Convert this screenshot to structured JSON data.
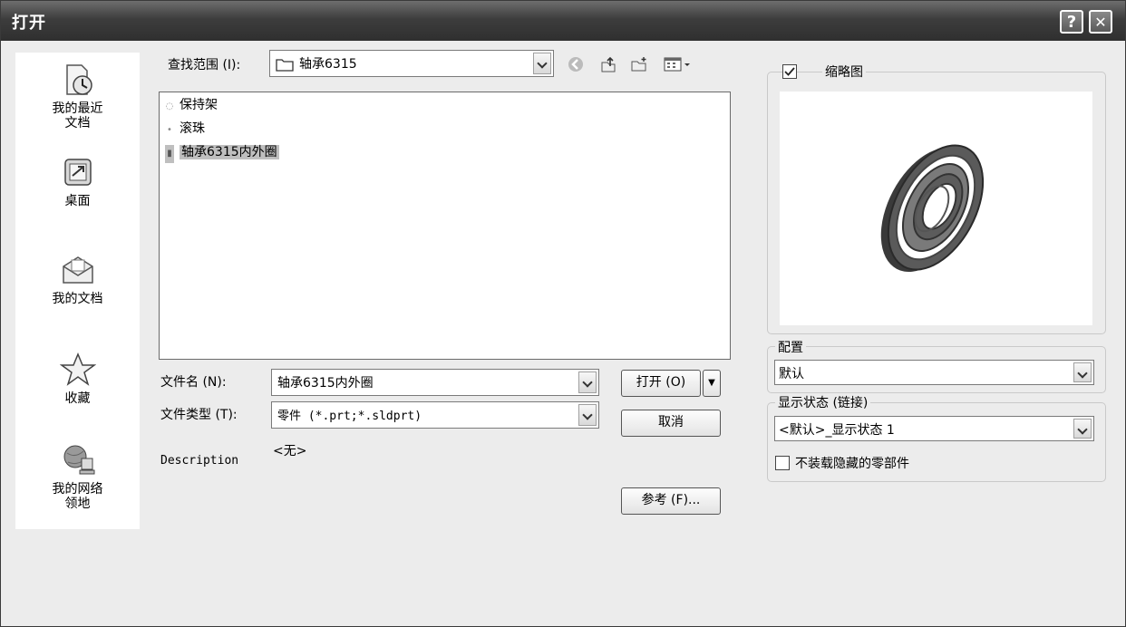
{
  "window": {
    "title": "打开",
    "help": "?",
    "close": "✕"
  },
  "places": [
    {
      "label": "我的最近\n文档",
      "icon": "recent-documents-icon"
    },
    {
      "label": "桌面",
      "icon": "desktop-icon"
    },
    {
      "label": "我的文档",
      "icon": "my-documents-icon"
    },
    {
      "label": "收藏",
      "icon": "favorites-star-icon"
    },
    {
      "label": "我的网络\n领地",
      "icon": "network-places-icon"
    }
  ],
  "lookin": {
    "label": "查找范围 (I):",
    "value": "轴承6315"
  },
  "files": [
    {
      "name": "保持架",
      "selected": false
    },
    {
      "name": "滚珠",
      "selected": false
    },
    {
      "name": "轴承6315内外圈",
      "selected": true
    }
  ],
  "filename": {
    "label": "文件名 (N):",
    "value": "轴承6315内外圈"
  },
  "filetype": {
    "label": "文件类型 (T):",
    "value": "零件 (*.prt;*.sldprt)"
  },
  "description": {
    "label": "Description",
    "value": "<无>"
  },
  "buttons": {
    "open": "打开 (O)",
    "cancel": "取消",
    "references": "参考 (F)..."
  },
  "thumbnail": {
    "label": "缩略图",
    "checked": true
  },
  "configuration": {
    "label": "配置",
    "value": "默认"
  },
  "display_state": {
    "label": "显示状态 (链接)",
    "value": "<默认>_显示状态 1"
  },
  "hidden_components": {
    "label": "不装载隐藏的零部件",
    "checked": false
  },
  "colors": {
    "titlebar": "#3d3d3d",
    "dialog_bg": "#ececec",
    "selection": "#bfbfbf"
  }
}
